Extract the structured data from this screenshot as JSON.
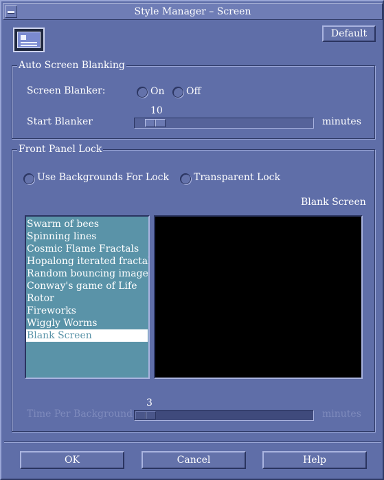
{
  "window": {
    "title": "Style Manager – Screen",
    "menu_icon": "window-menu-icon"
  },
  "toolbar": {
    "default_label": "Default",
    "icon": "screen-monitor-icon"
  },
  "auto_blanking": {
    "title": "Auto Screen Blanking",
    "screen_blanker_label": "Screen Blanker:",
    "on_label": "On",
    "off_label": "Off",
    "start_blanker_label": "Start Blanker",
    "start_blanker_value": "10",
    "minutes_label": "minutes"
  },
  "front_panel_lock": {
    "title": "Front Panel Lock",
    "use_backgrounds_label": "Use Backgrounds For Lock",
    "transparent_lock_label": "Transparent Lock",
    "preview_caption": "Blank Screen",
    "backgrounds": [
      "Swarm of bees",
      "Spinning lines",
      "Cosmic Flame Fractals",
      "Hopalong iterated fractals",
      "Random bouncing image",
      "Conway's game of Life",
      "Rotor",
      "Fireworks",
      "Wiggly Worms",
      "Blank Screen"
    ],
    "selected_background": "Blank Screen",
    "time_per_background_label": "Time Per Background",
    "time_per_background_value": "3",
    "minutes_label": "minutes"
  },
  "footer": {
    "ok_label": "OK",
    "cancel_label": "Cancel",
    "help_label": "Help"
  }
}
